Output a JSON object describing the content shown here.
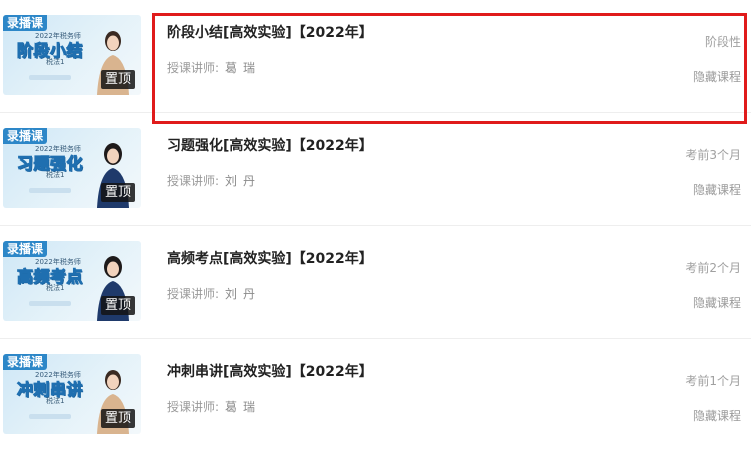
{
  "courses": [
    {
      "tag": "录播课",
      "thumb_year": "2022年税务师",
      "thumb_title": "阶段小结",
      "thumb_sub": "税法1",
      "pin": "置顶",
      "title": "阶段小结[高效实验]【2022年】",
      "teacher_label": "授课讲师:",
      "teacher_name": "葛瑞",
      "status": "阶段性",
      "hide": "隐藏课程",
      "person_color": "#d9b48f"
    },
    {
      "tag": "录播课",
      "thumb_year": "2022年税务师",
      "thumb_title": "习题强化",
      "thumb_sub": "税法1",
      "pin": "置顶",
      "title": "习题强化[高效实验]【2022年】",
      "teacher_label": "授课讲师:",
      "teacher_name": "刘丹",
      "status": "考前3个月",
      "hide": "隐藏课程",
      "person_color": "#1f3a6b"
    },
    {
      "tag": "录播课",
      "thumb_year": "2022年税务师",
      "thumb_title": "高频考点",
      "thumb_sub": "税法1",
      "pin": "置顶",
      "title": "高频考点[高效实验]【2022年】",
      "teacher_label": "授课讲师:",
      "teacher_name": "刘丹",
      "status": "考前2个月",
      "hide": "隐藏课程",
      "person_color": "#1f3a6b"
    },
    {
      "tag": "录播课",
      "thumb_year": "2022年税务师",
      "thumb_title": "冲刺串讲",
      "thumb_sub": "税法1",
      "pin": "置顶",
      "title": "冲刺串讲[高效实验]【2022年】",
      "teacher_label": "授课讲师:",
      "teacher_name": "葛瑞",
      "status": "考前1个月",
      "hide": "隐藏课程",
      "person_color": "#d9b48f"
    }
  ],
  "highlight_color": "#e01b1b"
}
